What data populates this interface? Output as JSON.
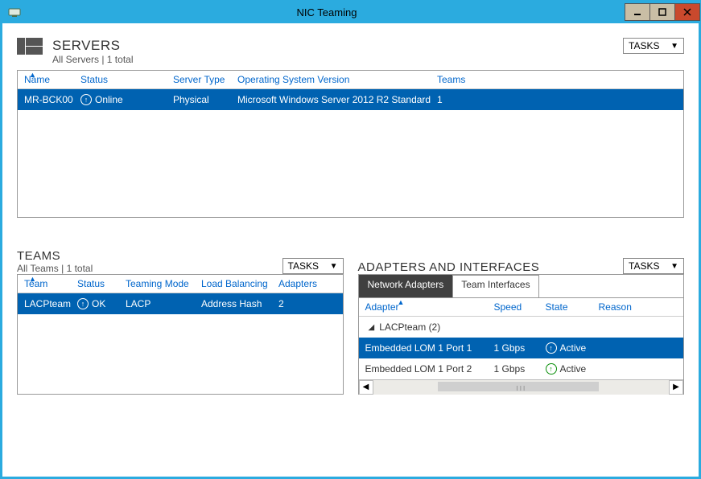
{
  "window": {
    "title": "NIC Teaming"
  },
  "servers": {
    "title": "SERVERS",
    "subtitle": "All Servers | 1 total",
    "tasks_label": "TASKS",
    "cols": {
      "name": "Name",
      "status": "Status",
      "type": "Server Type",
      "os": "Operating System Version",
      "teams": "Teams"
    },
    "row": {
      "name": "MR-BCK00",
      "status": "Online",
      "type": "Physical",
      "os": "Microsoft Windows Server 2012 R2 Standard",
      "teams": "1"
    }
  },
  "teams": {
    "title": "TEAMS",
    "subtitle": "All Teams | 1 total",
    "tasks_label": "TASKS",
    "cols": {
      "team": "Team",
      "status": "Status",
      "mode": "Teaming Mode",
      "lb": "Load Balancing",
      "adapters": "Adapters"
    },
    "row": {
      "team": "LACPteam",
      "status": "OK",
      "mode": "LACP",
      "lb": "Address Hash",
      "adapters": "2"
    }
  },
  "adapters": {
    "title": "ADAPTERS AND INTERFACES",
    "tasks_label": "TASKS",
    "tabs": {
      "network": "Network Adapters",
      "team": "Team Interfaces"
    },
    "cols": {
      "adapter": "Adapter",
      "speed": "Speed",
      "state": "State",
      "reason": "Reason"
    },
    "group": "LACPteam (2)",
    "row1": {
      "adapter": "Embedded LOM 1 Port 1",
      "speed": "1 Gbps",
      "state": "Active"
    },
    "row2": {
      "adapter": "Embedded LOM 1 Port 2",
      "speed": "1 Gbps",
      "state": "Active"
    }
  }
}
